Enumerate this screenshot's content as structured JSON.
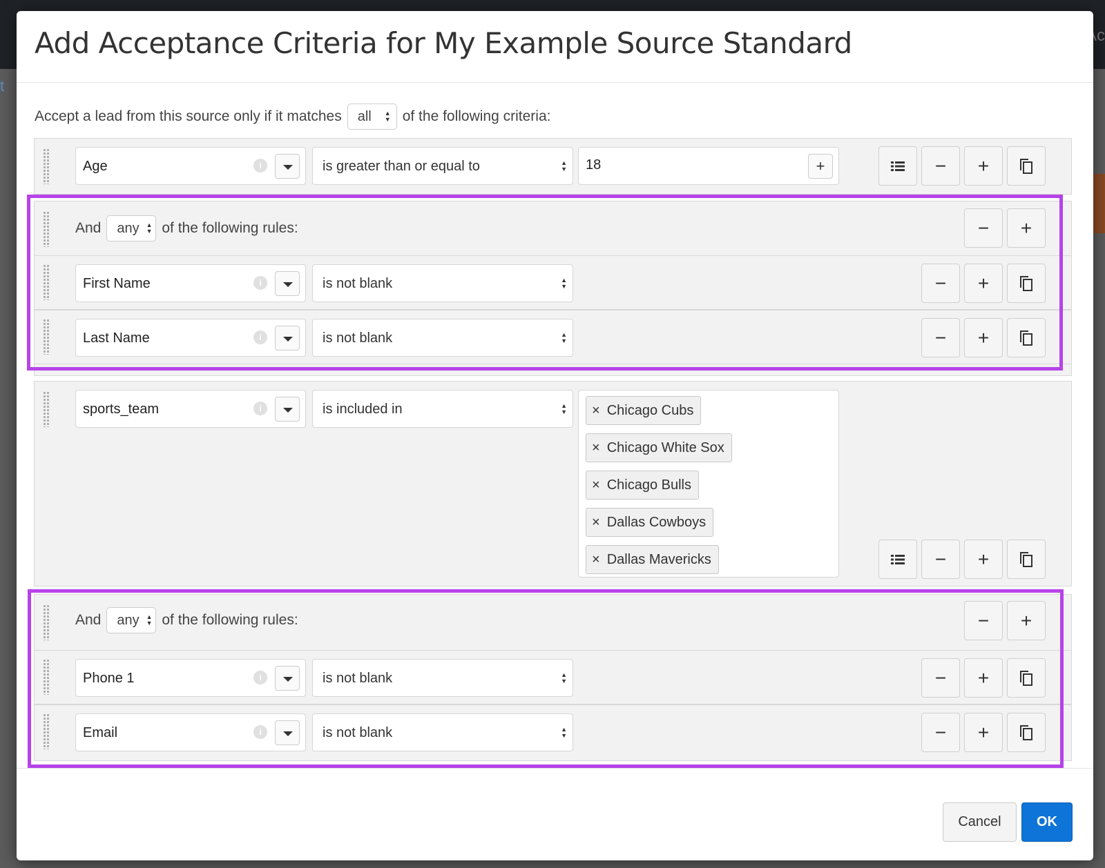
{
  "background": {
    "left_text": "t",
    "right_text": "Ac"
  },
  "modal": {
    "title": "Add Acceptance Criteria for My Example Source Standard",
    "intro_prefix": "Accept a lead from this source only if it matches",
    "intro_match": "all",
    "intro_suffix": "of the following criteria:"
  },
  "rules": {
    "age": {
      "field": "Age",
      "operator": "is greater than or equal to",
      "value": "18"
    },
    "group1": {
      "prefix": "And",
      "match": "any",
      "suffix": "of the following rules:",
      "rules": [
        {
          "field": "First Name",
          "operator": "is not blank"
        },
        {
          "field": "Last Name",
          "operator": "is not blank"
        }
      ]
    },
    "sports": {
      "field": "sports_team",
      "operator": "is included in",
      "tags": [
        "Chicago Cubs",
        "Chicago White Sox",
        "Chicago Bulls",
        "Dallas Cowboys",
        "Dallas Mavericks"
      ]
    },
    "group2": {
      "prefix": "And",
      "match": "any",
      "suffix": "of the following rules:",
      "rules": [
        {
          "field": "Phone 1",
          "operator": "is not blank"
        },
        {
          "field": "Email",
          "operator": "is not blank"
        }
      ]
    }
  },
  "buttons": {
    "remove": "−",
    "add": "+",
    "value_add": "+",
    "tag_remove": "×",
    "info": "i",
    "cancel": "Cancel",
    "ok": "OK"
  },
  "colors": {
    "highlight_outline": "#b643e8",
    "ok_button": "#0e74d8"
  }
}
